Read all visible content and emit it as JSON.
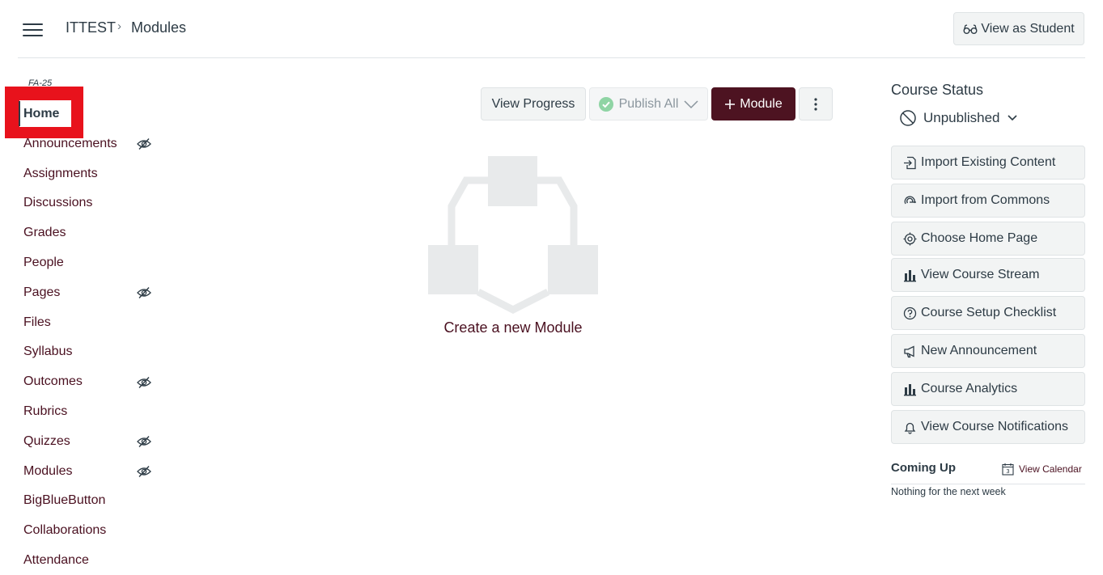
{
  "header": {
    "breadcrumb": {
      "course": "ITTEST",
      "separator": "›",
      "current": "Modules"
    },
    "view_as_student_label": "View as Student"
  },
  "sidebar": {
    "term": "FA-25",
    "items": [
      {
        "label": "Home",
        "active": true,
        "hidden_from_students": false
      },
      {
        "label": "Announcements",
        "hidden_from_students": true
      },
      {
        "label": "Assignments",
        "hidden_from_students": false
      },
      {
        "label": "Discussions",
        "hidden_from_students": false
      },
      {
        "label": "Grades",
        "hidden_from_students": false
      },
      {
        "label": "People",
        "hidden_from_students": false
      },
      {
        "label": "Pages",
        "hidden_from_students": true
      },
      {
        "label": "Files",
        "hidden_from_students": false
      },
      {
        "label": "Syllabus",
        "hidden_from_students": false
      },
      {
        "label": "Outcomes",
        "hidden_from_students": true
      },
      {
        "label": "Rubrics",
        "hidden_from_students": false
      },
      {
        "label": "Quizzes",
        "hidden_from_students": true
      },
      {
        "label": "Modules",
        "hidden_from_students": true
      },
      {
        "label": "BigBlueButton",
        "hidden_from_students": false
      },
      {
        "label": "Collaborations",
        "hidden_from_students": false
      },
      {
        "label": "Attendance",
        "hidden_from_students": false
      }
    ]
  },
  "toolbar": {
    "view_progress_label": "View Progress",
    "publish_all_label": "Publish All",
    "add_module_label": "Module",
    "more_options_icon": "kebab-icon"
  },
  "main": {
    "empty_state_label": "Create a new Module",
    "empty_state_icon": "modules-placeholder-icon"
  },
  "course_status": {
    "title": "Course Status",
    "status_label": "Unpublished",
    "actions": [
      {
        "label": "Import Existing Content",
        "icon": "import-icon"
      },
      {
        "label": "Import from Commons",
        "icon": "commons-icon"
      },
      {
        "label": "Choose Home Page",
        "icon": "target-icon"
      },
      {
        "label": "View Course Stream",
        "icon": "bar-chart-icon"
      },
      {
        "label": "Course Setup Checklist",
        "icon": "question-icon"
      },
      {
        "label": "New Announcement",
        "icon": "megaphone-icon"
      },
      {
        "label": "Course Analytics",
        "icon": "bar-chart-icon"
      },
      {
        "label": "View Course Notifications",
        "icon": "bell-icon"
      }
    ]
  },
  "coming_up": {
    "title": "Coming Up",
    "view_calendar_label": "View Calendar",
    "calendar_icon_day": "3",
    "empty_message": "Nothing for the next week"
  },
  "colors": {
    "brand_primary": "#4d1321",
    "link": "#4a1020",
    "text": "#2d3b45",
    "highlight_box": "#e8121c",
    "publish_check": "#8fd4a4"
  }
}
